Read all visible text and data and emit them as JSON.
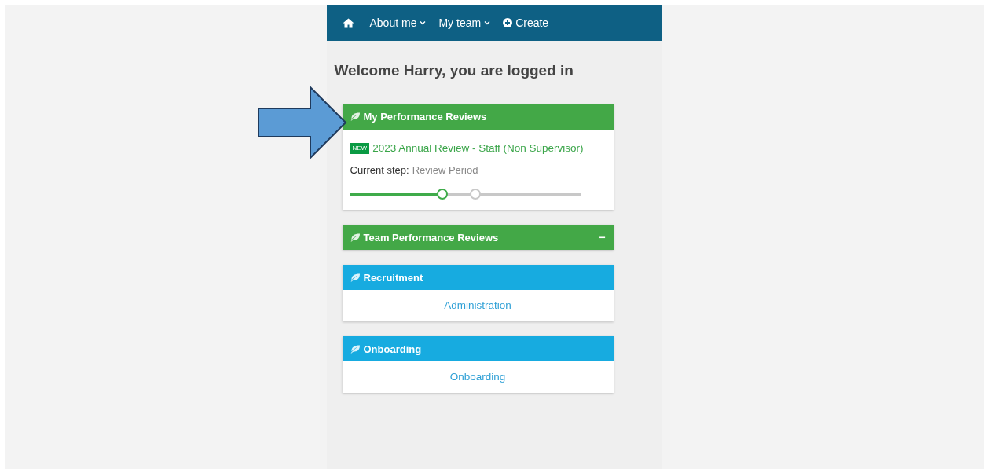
{
  "nav": {
    "items": [
      {
        "kind": "home"
      },
      {
        "kind": "menu",
        "label": "About me",
        "caret": true
      },
      {
        "kind": "menu",
        "label": "My team",
        "caret": true
      },
      {
        "kind": "create",
        "label": "Create"
      }
    ]
  },
  "welcome": "Welcome Harry, you are logged in",
  "callout": {
    "kind": "arrow"
  },
  "panels": [
    {
      "title": "My Performance Reviews",
      "color": "#43a847",
      "kind": "review",
      "badge": "NEW",
      "link": "2023 Annual Review - Staff (Non Supervisor)",
      "step_label": "Current step:",
      "step_value": "Review Period",
      "level": 0.4,
      "steps": [
        {
          "selected": true
        },
        {
          "selected": false
        }
      ]
    },
    {
      "title": "Team Performance Reviews",
      "color": "#43a847",
      "kind": "collapsed",
      "toggle": "−"
    },
    {
      "title": "Recruitment",
      "color": "#17abe0",
      "kind": "link",
      "link": "Administration"
    },
    {
      "title": "Onboarding",
      "color": "#17abe0",
      "kind": "link",
      "link": "Onboarding"
    }
  ]
}
